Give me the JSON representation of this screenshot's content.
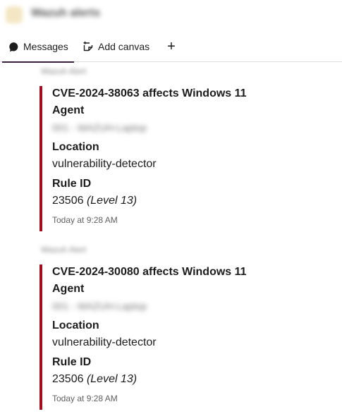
{
  "header": {
    "channel_name": "Wazuh alerts"
  },
  "tabs": [
    {
      "label": "Messages",
      "icon": "message-bubble-icon",
      "active": true
    },
    {
      "label": "Add canvas",
      "icon": "canvas-icon"
    },
    {
      "label": "+",
      "icon": "plus-icon"
    }
  ],
  "messages": [
    {
      "sender": "Wazuh Alert",
      "title": "CVE-2024-38063 affects Windows 11",
      "agent_label": "Agent",
      "agent_value": "001 - WAZUH-Laptop",
      "location_label": "Location",
      "location_value": "vulnerability-detector",
      "rule_label": "Rule ID",
      "rule_id": "23506",
      "rule_level": "(Level 13)",
      "timestamp": "Today at 9:28 AM"
    },
    {
      "sender": "Wazuh Alert",
      "title": "CVE-2024-30080 affects Windows 11",
      "agent_label": "Agent",
      "agent_value": "001 - WAZUH-Laptop",
      "location_label": "Location",
      "location_value": "vulnerability-detector",
      "rule_label": "Rule ID",
      "rule_id": "23506",
      "rule_level": "(Level 13)",
      "timestamp": "Today at 9:28 AM"
    }
  ],
  "colors": {
    "attachment_bar": "#a30d1f",
    "active_tab_underline": "#3c1f3e"
  }
}
